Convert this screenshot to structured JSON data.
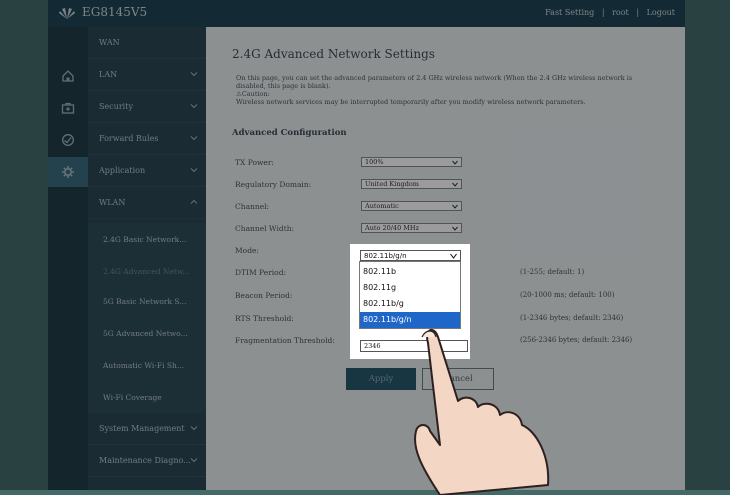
{
  "header": {
    "model": "EG8145V5",
    "links": [
      "Fast Setting",
      "|",
      "root",
      "|",
      "Logout"
    ]
  },
  "iconbar": [
    {
      "name": "home-icon"
    },
    {
      "name": "toolbox-icon"
    },
    {
      "name": "diagnose-icon"
    },
    {
      "name": "gear-icon"
    }
  ],
  "nav": {
    "items": [
      {
        "label": "WAN"
      },
      {
        "label": "LAN"
      },
      {
        "label": "Security"
      },
      {
        "label": "Forward Rules"
      },
      {
        "label": "Application"
      },
      {
        "label": "WLAN"
      }
    ],
    "subitems": [
      {
        "label": "2.4G Basic Network..."
      },
      {
        "label": "2.4G Advanced Netw..."
      },
      {
        "label": "5G Basic Network S..."
      },
      {
        "label": "5G Advanced Netwo..."
      },
      {
        "label": "Automatic Wi-Fi Sh..."
      },
      {
        "label": "Wi-Fi Coverage"
      }
    ],
    "bottom": [
      {
        "label": "System Management"
      },
      {
        "label": "Maintenance Diagno..."
      }
    ]
  },
  "main": {
    "title": "2.4G Advanced Network Settings",
    "description": "On this page, you can set the advanced parameters of 2.4 GHz wireless network (When the 2.4 GHz wireless network is disabled, this page is blank).",
    "caution_label": "Caution:",
    "caution_text": "Wireless network services may be interrupted temporarily after you modify wireless network parameters.",
    "section": "Advanced Configuration",
    "fields": {
      "tx_power": {
        "label": "TX Power:",
        "value": "100%"
      },
      "regulatory": {
        "label": "Regulatory Domain:",
        "value": "United Kingdom"
      },
      "channel": {
        "label": "Channel:",
        "value": "Automatic"
      },
      "channel_width": {
        "label": "Channel Width:",
        "value": "Auto 20/40 MHz"
      },
      "mode": {
        "label": "Mode:",
        "value": "802.11b/g/n"
      },
      "dtim": {
        "label": "DTIM Period:",
        "hint": "(1-255; default: 1)"
      },
      "beacon": {
        "label": "Beacon Period:",
        "hint": "(20-1000 ms; default: 100)"
      },
      "rts": {
        "label": "RTS Threshold:",
        "hint": "(1-2346 bytes; default: 2346)"
      },
      "frag": {
        "label": "Fragmentation Threshold:",
        "value": "2346",
        "hint": "(256-2346 bytes; default: 2346)"
      }
    },
    "mode_options": [
      "802.11b",
      "802.11g",
      "802.11b/g",
      "802.11b/g/n"
    ],
    "selected_option_index": 3,
    "apply_label": "Apply",
    "cancel_label": "Cancel"
  },
  "colors": {
    "accent": "#1f66c9",
    "topbar": "#1f4556",
    "sidebar": "#2a4653"
  }
}
